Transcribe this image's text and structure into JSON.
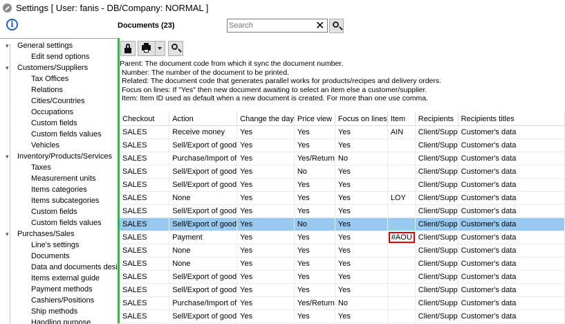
{
  "window": {
    "title": "Settings   [ User: fanis - DB/Company: NORMAL ]"
  },
  "header": {
    "documents_label": "Documents (23)",
    "search_placeholder": "Search",
    "search_value": ""
  },
  "toolbar": {
    "lock_icon": "lock-icon",
    "print_icon": "printer-icon",
    "find_icon": "magnifier-icon"
  },
  "help_lines": [
    "Parent: The document code from which it sync the document number.",
    "Number: The number of the document to be printed.",
    "Related: The document code that generates parallel works for products/recipes and delivery orders.",
    "Focus on lines: If \"Yes\" then new document awaiting to select an item else a customer/supplier.",
    "Item: Item ID used as default when a new document is created. For more than one use comma."
  ],
  "tree": [
    {
      "label": "General settings",
      "level": 0,
      "expander": "⌄"
    },
    {
      "label": "Edit send options",
      "level": 1
    },
    {
      "label": "Customers/Suppliers",
      "level": 0,
      "expander": "⌄"
    },
    {
      "label": "Tax Offices",
      "level": 1
    },
    {
      "label": "Relations",
      "level": 1
    },
    {
      "label": "Cities/Countries",
      "level": 1
    },
    {
      "label": "Occupations",
      "level": 1
    },
    {
      "label": "Custom fields",
      "level": 1
    },
    {
      "label": "Custom fields values",
      "level": 1
    },
    {
      "label": "Vehicles",
      "level": 1
    },
    {
      "label": "Inventory/Products/Services",
      "level": 0,
      "expander": "⌄"
    },
    {
      "label": "Taxes",
      "level": 1
    },
    {
      "label": "Measurement units",
      "level": 1
    },
    {
      "label": "Items categories",
      "level": 1
    },
    {
      "label": "Items subcategories",
      "level": 1
    },
    {
      "label": "Custom fields",
      "level": 1
    },
    {
      "label": "Custom fields values",
      "level": 1
    },
    {
      "label": "Purchases/Sales",
      "level": 0,
      "expander": "⌄"
    },
    {
      "label": "Line's settings",
      "level": 1
    },
    {
      "label": "Documents",
      "level": 1
    },
    {
      "label": "Data and documents desi",
      "level": 1
    },
    {
      "label": "Items external guide",
      "level": 1
    },
    {
      "label": "Payment methods",
      "level": 1
    },
    {
      "label": "Cashiers/Positions",
      "level": 1
    },
    {
      "label": "Ship methods",
      "level": 1
    },
    {
      "label": "Handling purpose",
      "level": 1
    }
  ],
  "table": {
    "columns": [
      "Checkout",
      "Action",
      "Change the day",
      "Price view",
      "Focus on lines",
      "Item",
      "Recipients",
      "Recipients titles"
    ],
    "selected_row": 7,
    "highlighted_cell": {
      "row": 8,
      "col": 5
    },
    "rows": [
      [
        "SALES",
        "Receive money",
        "Yes",
        "Yes",
        "Yes",
        "AIN",
        "Client/Supp",
        "Customer's data"
      ],
      [
        "SALES",
        "Sell/Export of good",
        "Yes",
        "Yes",
        "Yes",
        "",
        "Client/Supp",
        "Customer's data"
      ],
      [
        "SALES",
        "Purchase/Import of",
        "Yes",
        "Yes/Return",
        "No",
        "",
        "Client/Supp",
        "Customer's data"
      ],
      [
        "SALES",
        "Sell/Export of good",
        "Yes",
        "No",
        "Yes",
        "",
        "Client/Supp",
        "Customer's data"
      ],
      [
        "SALES",
        "Sell/Export of good",
        "Yes",
        "Yes",
        "Yes",
        "",
        "Client/Supp",
        "Customer's data"
      ],
      [
        "SALES",
        "None",
        "Yes",
        "Yes",
        "Yes",
        "LOY",
        "Client/Supp",
        "Customer's data"
      ],
      [
        "SALES",
        "Sell/Export of good",
        "Yes",
        "Yes",
        "Yes",
        "",
        "Client/Supp",
        "Customer's data"
      ],
      [
        "SALES",
        "Sell/Export of good",
        "Yes",
        "No",
        "Yes",
        "",
        "Client/Supp",
        "Customer's data"
      ],
      [
        "SALES",
        "Payment",
        "Yes",
        "Yes",
        "Yes",
        "#AOU",
        "Client/Supp",
        "Customer's data"
      ],
      [
        "SALES",
        "None",
        "Yes",
        "Yes",
        "Yes",
        "",
        "Client/Supp",
        "Customer's data"
      ],
      [
        "SALES",
        "None",
        "Yes",
        "Yes",
        "Yes",
        "",
        "Client/Supp",
        "Customer's data"
      ],
      [
        "SALES",
        "Sell/Export of good",
        "Yes",
        "Yes",
        "Yes",
        "",
        "Client/Supp",
        "Customer's data"
      ],
      [
        "SALES",
        "Sell/Export of good",
        "Yes",
        "Yes",
        "Yes",
        "",
        "Client/Supp",
        "Customer's data"
      ],
      [
        "SALES",
        "Purchase/Import of",
        "Yes",
        "Yes/Return",
        "No",
        "",
        "Client/Supp",
        "Customer's data"
      ],
      [
        "SALES",
        "Sell/Export of good",
        "Yes",
        "Yes",
        "Yes",
        "",
        "Client/Supp",
        "Customer's data"
      ]
    ]
  }
}
